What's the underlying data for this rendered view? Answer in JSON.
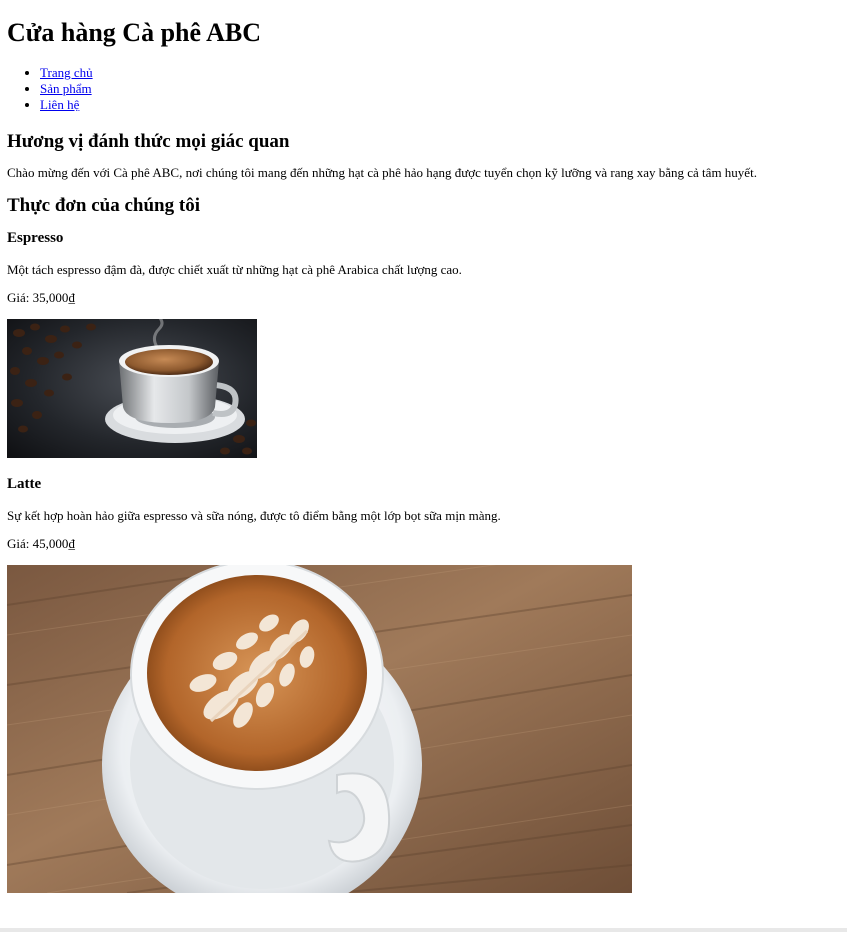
{
  "site": {
    "title": "Cửa hàng Cà phê ABC"
  },
  "nav": {
    "items": [
      {
        "label": "Trang chủ"
      },
      {
        "label": "Sản phẩm"
      },
      {
        "label": "Liên hệ"
      }
    ],
    "link_color": "#0000ee"
  },
  "hero": {
    "heading": "Hương vị đánh thức mọi giác quan",
    "text": "Chào mừng đến với Cà phê ABC, nơi chúng tôi mang đến những hạt cà phê hảo hạng được tuyển chọn kỹ lưỡng và rang xay bằng cả tâm huyết."
  },
  "menu": {
    "heading": "Thực đơn của chúng tôi",
    "items": [
      {
        "name": "Espresso",
        "description": "Một tách espresso đậm đà, được chiết xuất từ những hạt cà phê Arabica chất lượng cao.",
        "price": "Giá: 35,000₫"
      },
      {
        "name": "Latte",
        "description": "Sự kết hợp hoàn hảo giữa espresso và sữa nóng, được tô điểm bằng một lớp bọt sữa mịn màng.",
        "price": "Giá: 45,000₫"
      }
    ]
  }
}
